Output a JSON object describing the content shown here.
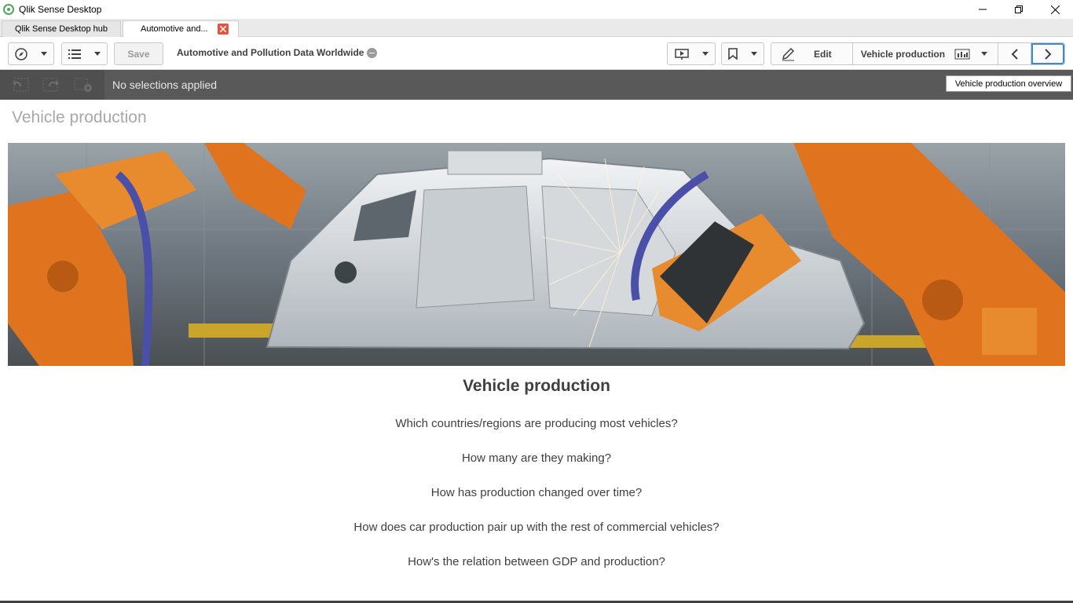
{
  "window": {
    "title": "Qlik Sense Desktop"
  },
  "tabs": [
    {
      "label": "Qlik Sense Desktop hub"
    },
    {
      "label": "Automotive and..."
    }
  ],
  "toolbar": {
    "save_label": "Save",
    "app_title": "Automotive and Pollution Data Worldwide",
    "edit_label": "Edit",
    "sheet_label": "Vehicle production"
  },
  "selections": {
    "status": "No selections applied"
  },
  "tooltip": {
    "text": "Vehicle production overview"
  },
  "sheet": {
    "title": "Vehicle production",
    "content_title": "Vehicle production",
    "questions": [
      "Which countries/regions are producing most vehicles?",
      "How many are they making?",
      "How has production changed over time?",
      "How does car production pair up with the rest of commercial vehicles?",
      "How's the relation between GDP and production?"
    ]
  },
  "colors": {
    "selection_bar": "#595959",
    "accent_blue": "#3c8ad6",
    "robot_orange": "#e0731e",
    "close_red": "#e5533d"
  }
}
